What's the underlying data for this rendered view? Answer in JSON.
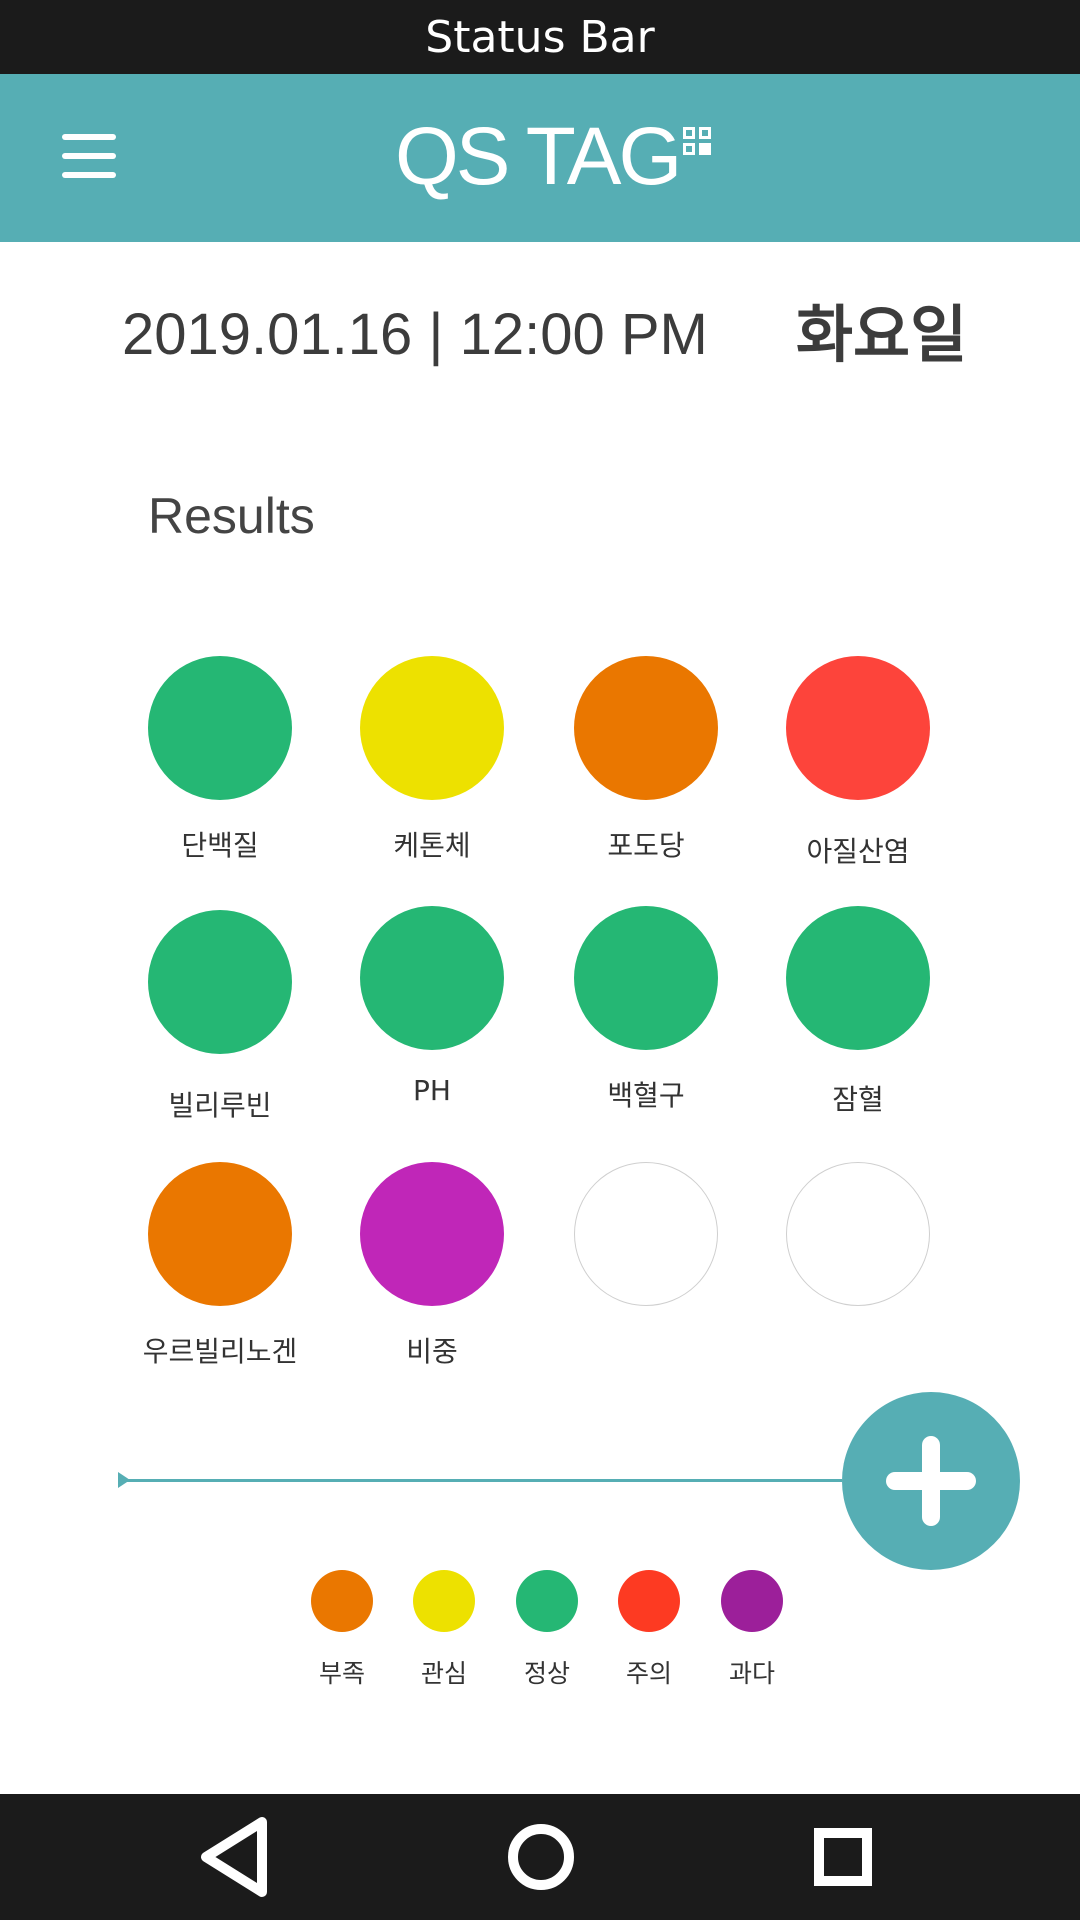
{
  "status_bar": {
    "label": "Status Bar"
  },
  "app_bar": {
    "brand": "QS TAG"
  },
  "header": {
    "datetime": "2019.01.16 | 12:00 PM",
    "weekday": "화요일"
  },
  "section": {
    "title": "Results"
  },
  "results": [
    {
      "label": "단백질",
      "color": "#25b774"
    },
    {
      "label": "케톤체",
      "color": "#ede100"
    },
    {
      "label": "포도당",
      "color": "#ea7700"
    },
    {
      "label": "아질산염",
      "color": "#fd443b"
    },
    {
      "label": "빌리루빈",
      "color": "#25b774"
    },
    {
      "label": "PH",
      "color": "#25b774"
    },
    {
      "label": "백혈구",
      "color": "#25b774"
    },
    {
      "label": "잠혈",
      "color": "#25b774"
    },
    {
      "label": "우르빌리노겐",
      "color": "#ea7700"
    },
    {
      "label": "비중",
      "color": "#c026b8"
    },
    {
      "label": "",
      "color": "empty"
    },
    {
      "label": "",
      "color": "empty"
    }
  ],
  "legend": [
    {
      "label": "부족",
      "color": "#ea7700"
    },
    {
      "label": "관심",
      "color": "#ede100"
    },
    {
      "label": "정상",
      "color": "#25b774"
    },
    {
      "label": "주의",
      "color": "#fd3a22"
    },
    {
      "label": "과다",
      "color": "#9c1f9a"
    }
  ],
  "colors": {
    "accent": "#56aeb4",
    "system_bar": "#1b1b1b"
  },
  "icons": {
    "menu": "hamburger-icon",
    "add": "plus-icon",
    "back": "back-triangle-icon",
    "home": "home-circle-icon",
    "recents": "recents-square-icon"
  }
}
